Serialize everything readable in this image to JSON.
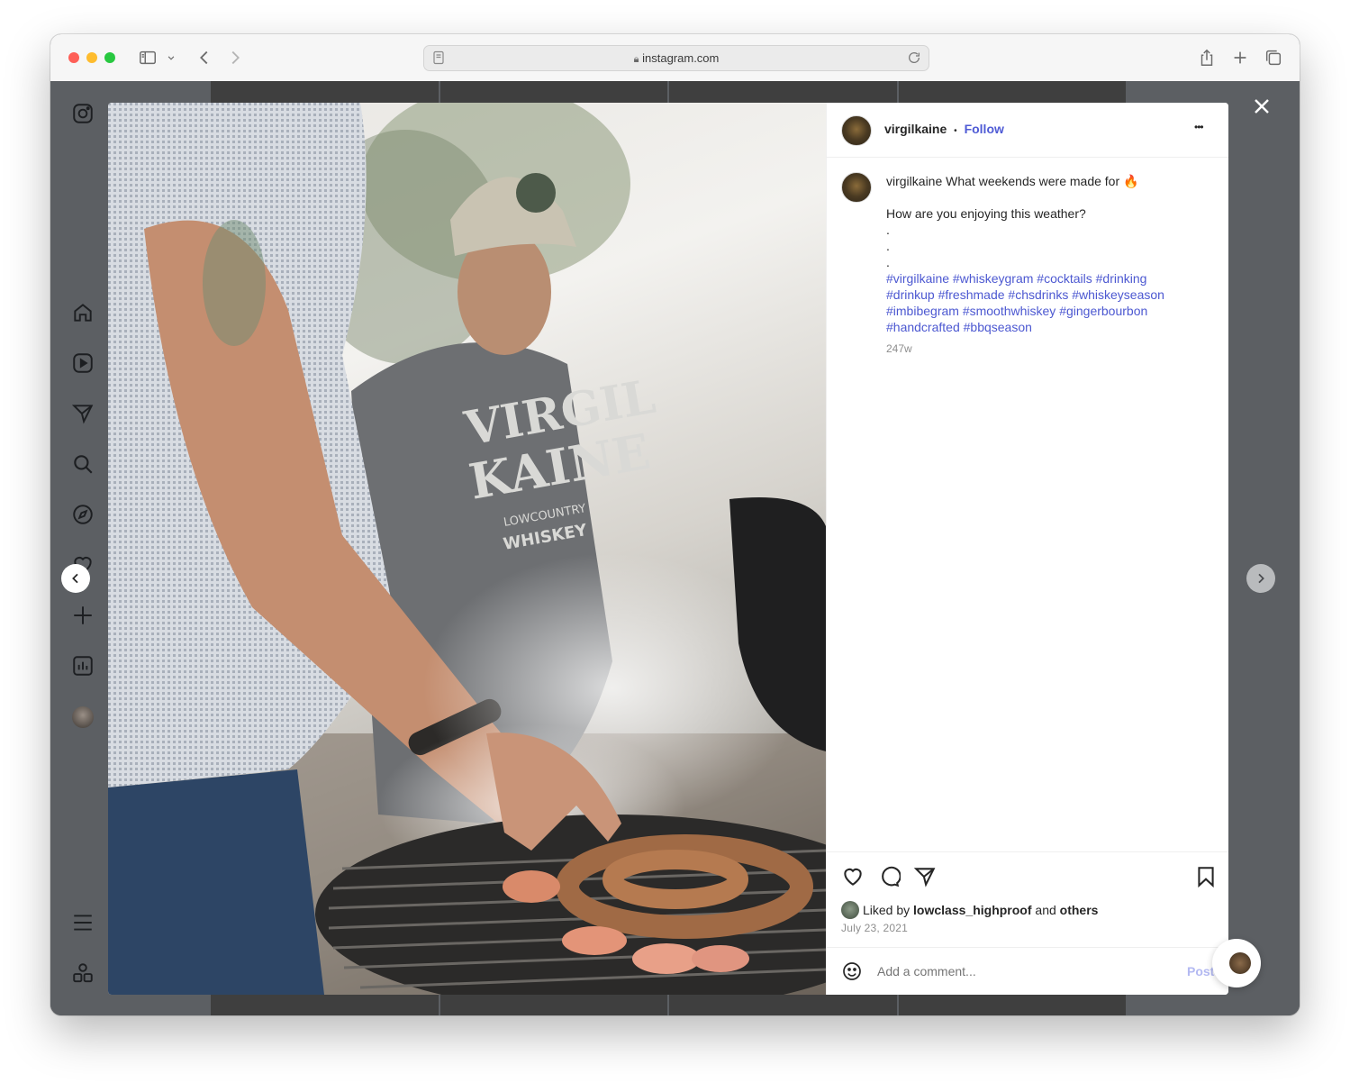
{
  "browser": {
    "url": "instagram.com"
  },
  "post": {
    "username": "virgilkaine",
    "follow_label": "Follow",
    "more_label": "•••",
    "dot_separator": "•",
    "caption_user": "virgilkaine",
    "caption_text": "What weekends were made for 🔥",
    "caption_line2": "How are you enjoying this weather?",
    "caption_dots": [
      ".",
      ".",
      "."
    ],
    "hashtag_lines": [
      "#virgilkaine #whiskeygram #cocktails #drinking",
      "#drinkup #freshmade #chsdrinks #whiskeyseason",
      "#imbibegram #smoothwhiskey #gingerbourbon",
      "#handcrafted #bbqseason"
    ],
    "age": "247w",
    "likes_prefix": "Liked by",
    "likes_user": "lowclass_highproof",
    "likes_and": "and",
    "likes_others": "others",
    "date": "July 23, 2021",
    "comment_placeholder": "Add a comment...",
    "post_button": "Post"
  },
  "shirt_text": {
    "line1": "VIRGIL",
    "line2": "KAINE",
    "line3": "LOWCOUNTRY",
    "line4": "WHISKEY"
  },
  "icons": {
    "close": "close-icon",
    "prev": "chevron-left-icon",
    "next": "chevron-right-icon"
  },
  "colors": {
    "link_blue": "#4f5bd5",
    "backdrop": "#5c5f63"
  }
}
